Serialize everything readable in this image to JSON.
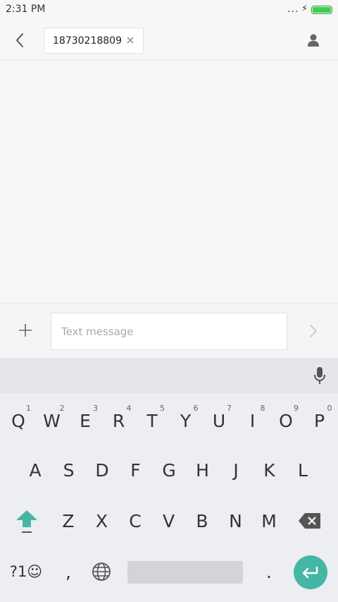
{
  "status_bar": {
    "time": "2:31 PM",
    "signal_dots": "...",
    "charging_glyph": "⚡",
    "battery_level": 1.0
  },
  "header": {
    "back_icon": "chevron-left-icon",
    "recipient": "18730218809",
    "remove_recipient_icon": "close-icon",
    "contact_icon": "person-icon"
  },
  "compose": {
    "attach_icon": "plus-icon",
    "placeholder": "Text message",
    "value": "",
    "send_icon": "chevron-right-icon"
  },
  "keyboard": {
    "toolbar": {
      "mic_icon": "microphone-icon"
    },
    "row1": [
      {
        "label": "Q",
        "hint": "1"
      },
      {
        "label": "W",
        "hint": "2"
      },
      {
        "label": "E",
        "hint": "3"
      },
      {
        "label": "R",
        "hint": "4"
      },
      {
        "label": "T",
        "hint": "5"
      },
      {
        "label": "Y",
        "hint": "6"
      },
      {
        "label": "U",
        "hint": "7"
      },
      {
        "label": "I",
        "hint": "8"
      },
      {
        "label": "O",
        "hint": "9"
      },
      {
        "label": "P",
        "hint": "0"
      }
    ],
    "row2": [
      "A",
      "S",
      "D",
      "F",
      "G",
      "H",
      "J",
      "K",
      "L"
    ],
    "row3": [
      "Z",
      "X",
      "C",
      "V",
      "B",
      "N",
      "M"
    ],
    "shift_icon": "shift-arrow-icon",
    "backspace_icon": "backspace-icon",
    "symbols_label": "?1☺",
    "comma_label": ",",
    "language_icon": "globe-icon",
    "period_label": ".",
    "enter_icon": "enter-icon",
    "colors": {
      "accent": "#45b6a4",
      "shift": "#45b6a4"
    }
  }
}
